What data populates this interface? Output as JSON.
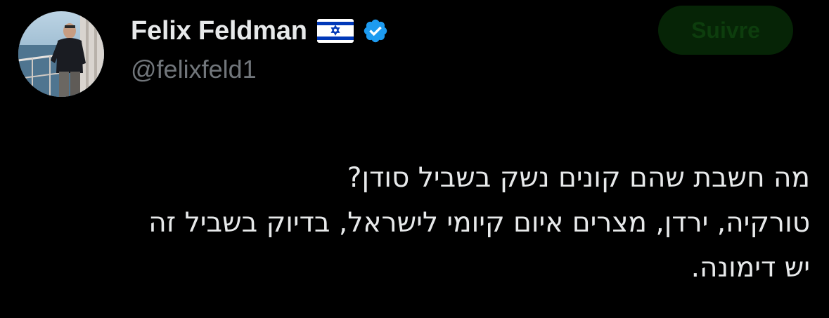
{
  "author": {
    "display_name": "Felix Feldman",
    "handle": "@felixfeld1",
    "flag_icon": "israel-flag-icon",
    "verified_icon": "verified-badge-icon",
    "verified_color": "#1d9bf0"
  },
  "actions": {
    "follow_label": "Suivre"
  },
  "tweet": {
    "lines": [
      "מה חשבת שהם קונים נשק בשביל סודן?",
      "טורקיה, ירדן, מצרים איום קיומי לישראל, בדיוק בשביל זה",
      "יש דימונה."
    ]
  },
  "colors": {
    "background": "#000000",
    "text_primary": "#e7e9ea",
    "text_secondary": "#71767b",
    "follow_button_bg": "#062406"
  }
}
